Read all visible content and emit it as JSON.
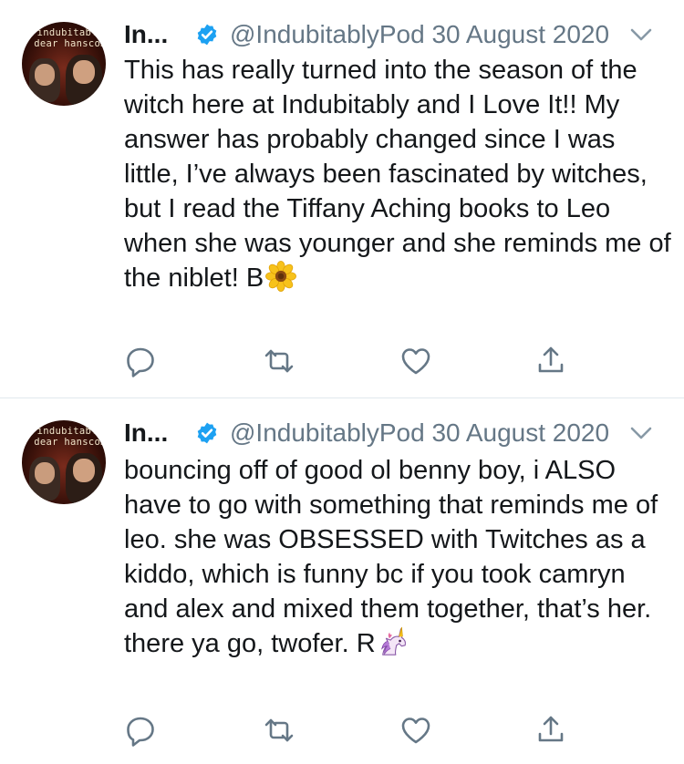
{
  "tweets": [
    {
      "author_name": "In...",
      "avatar_text": "indubitably dear hanscom",
      "handle_and_date": "@IndubitablyPod 30 August 2020",
      "text": "This has really turned into the season of the witch here at Indubitably and I Love It!! My answer has probably changed since I was little, I’ve always been fascinated by witches, but I read the Tiffany Aching books to Leo when she was younger and she reminds me of the niblet! B",
      "emoji": "sunflower",
      "actions": [
        "reply-icon",
        "retweet-icon",
        "like-icon",
        "share-icon"
      ]
    },
    {
      "author_name": "In...",
      "avatar_text": "indubitably dear hanscom",
      "handle_and_date": "@IndubitablyPod 30 August 2020",
      "text": "bouncing off of good ol benny boy, i ALSO have to go with something that reminds me of leo. she was OBSESSED with Twitches as a kiddo, which is funny bc if you took camryn and alex and mixed them together, that’s her. there ya go, twofer. R",
      "emoji": "unicorn",
      "actions": [
        "reply-icon",
        "retweet-icon",
        "like-icon",
        "share-icon"
      ]
    }
  ],
  "colors": {
    "text": "#14171a",
    "secondary": "#657786",
    "verified": "#1da1f2",
    "divider": "#e1e8ed",
    "icon": "#657786"
  }
}
